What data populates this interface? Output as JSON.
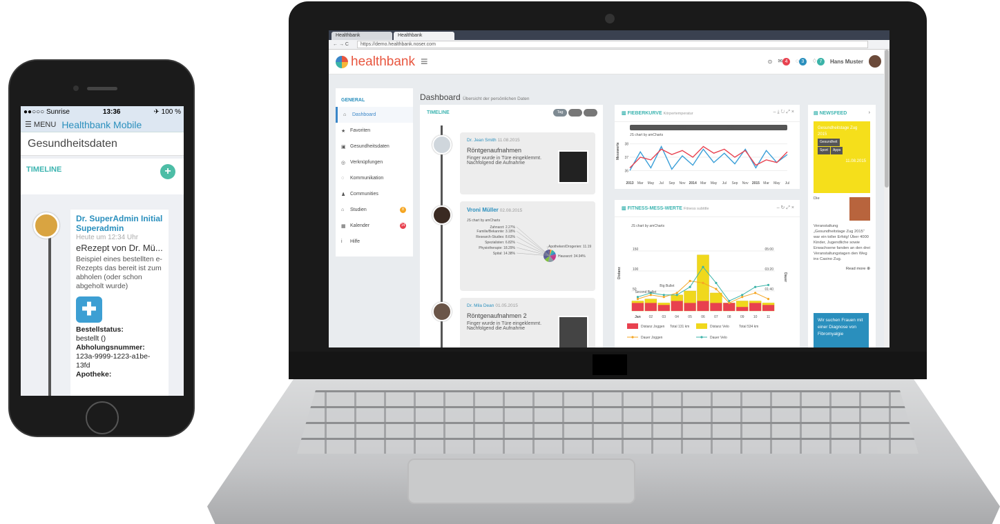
{
  "phone": {
    "status": {
      "carrier": "●●○○○ Sunrise",
      "time": "13:36",
      "battery": "✈ 100 %"
    },
    "nav": {
      "menu_label": "☰ MENU",
      "title": "Healthbank Mobile"
    },
    "page_title": "Gesundheitsdaten",
    "timeline_label": "TIMELINE",
    "add_icon": "plus-icon",
    "entry": {
      "author": "Dr. SuperAdmin Initial Superadmin",
      "time": "Heute um 12:34 Uhr",
      "subject": "eRezept von Dr. Mü...",
      "text": "Beispiel eines bestellten e-Rezepts das bereit ist zum abholen (oder schon abgeholt wurde)",
      "status_label": "Bestellstatus:",
      "status_value": "bestellt ()",
      "pickup_label": "Abholungsnummer:",
      "pickup_value": "123a-9999-1223-a1be-13fd",
      "pharmacy_label": "Apotheke:"
    }
  },
  "browser": {
    "tabs": [
      "Healthbank",
      "Healthbank"
    ],
    "url": "https://demo.healthbank.noser.com"
  },
  "app": {
    "logo": {
      "pre": "health",
      "post": "bank"
    },
    "user_name": "Hans Muster",
    "badges": {
      "mail": "4",
      "chat": "3",
      "notif": "7"
    },
    "sidebar": {
      "section": "GENERAL",
      "items": [
        {
          "label": "Dashboard",
          "icon": "home-icon"
        },
        {
          "label": "Favoriten",
          "icon": "star-icon"
        },
        {
          "label": "Gesundheitsdaten",
          "icon": "briefcase-icon"
        },
        {
          "label": "Verknüpfungen",
          "icon": "link-icon"
        },
        {
          "label": "Kommunikation",
          "icon": "chat-icon"
        },
        {
          "label": "Communities",
          "icon": "users-icon"
        },
        {
          "label": "Studien",
          "icon": "bank-icon",
          "badge": "8"
        },
        {
          "label": "Kalender",
          "icon": "calendar-icon",
          "badge": "14"
        },
        {
          "label": "Hilfe",
          "icon": "info-icon"
        }
      ]
    },
    "dashboard_title": "Dashboard",
    "dashboard_subtitle": "Übersicht der persönlichen Daten",
    "timeline": {
      "label": "TIMELINE",
      "buttons": [
        "Tag",
        "",
        ""
      ],
      "entries": [
        {
          "who": "Dr. Jean Smith",
          "date": "11.08.2015",
          "subject": "Röntgenaufnahmen",
          "text": "Finger wurde in Türe eingeklemmt. Nachfolgend die Aufnahme"
        },
        {
          "who": "Vroni Müller",
          "date": "02.08.2015"
        },
        {
          "who": "Dr. Mila Dean",
          "date": "01.05.2015",
          "subject": "Röntgenaufnahmen 2",
          "text": "Finger wurde in Türe eingeklemmt. Nachfolgend die Aufnahme"
        }
      ],
      "pie_note": "JS chart by amCharts"
    },
    "fever": {
      "title": "FIEBERKURVE",
      "subtitle": "Körpertemperatur",
      "note": "JS chart by amCharts",
      "ylabel": "Messwerte"
    },
    "fitness": {
      "title": "FITNESS-MESS-WERTE",
      "subtitle": "Fitness subtitle",
      "note": "JS chart by amCharts",
      "ylabel": "Distanz",
      "y2label": "Dauer"
    },
    "newsfeed": {
      "title": "NEWSFEED",
      "card_title": "Gesundheitstage Zug 2015",
      "tags": [
        "Gesundheit",
        "Sport",
        "Apps"
      ],
      "date": "11.08.2015",
      "lead": "Die",
      "text": "Veranstaltung „Gesundheitstage Zug 2015“ war ein toller Erfolg! Über 4000 Kinder, Jugendliche sowie Erwachsene fanden an den drei Veranstaltungstagen den Weg ins Casino Zug.",
      "read_more": "Read more",
      "blue_text": "Wir suchen Frauen mit einer Diagnose von Fibromyalgie"
    }
  },
  "chart_data": [
    {
      "type": "pie",
      "title": "",
      "categories": [
        "Zahnarzt",
        "Familie/Bekannte",
        "Research-Studies",
        "Spezialisten",
        "Physiotherapie",
        "Spital",
        "Apotheken/Drogerien",
        "Hausarzt"
      ],
      "values": [
        2.27,
        3.18,
        8.63,
        6.82,
        18.29,
        14.38,
        11.19,
        34.94
      ],
      "labels": [
        "Zahnarzt: 2.27%",
        "Familie/Bekannte: 3.18%",
        "Research-Studies: 8.63%",
        "Spezialisten: 6.82%",
        "Physiotherapie: 18.29%",
        "Spital: 14.38%",
        "Apotheken/Drogerien: 11.19%",
        "Hausarzt: 34.94%"
      ],
      "colors": [
        "#e8563f",
        "#f5b63a",
        "#3bb3a8",
        "#3a86c8",
        "#c23b8a",
        "#8a9aa6",
        "#7fbf3f",
        "#5b5f96"
      ]
    },
    {
      "type": "line",
      "title": "FIEBERKURVE",
      "ylabel": "Messwerte",
      "x": [
        "2013",
        "Mar",
        "May",
        "Jul",
        "Sep",
        "Nov",
        "2014",
        "Mar",
        "May",
        "Jul",
        "Sep",
        "Nov",
        "2015",
        "Mar",
        "May",
        "Jul"
      ],
      "yticks": [
        "38",
        "37",
        "36"
      ],
      "ylim": [
        35.5,
        38.5
      ],
      "series": [
        {
          "name": "",
          "values": [
            36.0,
            37.4,
            36.2,
            37.8,
            36.1,
            37.1,
            36.4,
            37.6,
            36.6,
            37.3,
            36.5,
            37.6,
            36.2,
            37.5,
            36.6,
            37.2
          ],
          "color": "#3a9fd8"
        },
        {
          "name": "",
          "values": [
            36.2,
            37.0,
            36.8,
            37.6,
            37.2,
            37.5,
            37.0,
            37.8,
            37.3,
            37.6,
            37.0,
            37.5,
            36.4,
            36.8,
            36.6,
            37.4
          ],
          "color": "#e8414f"
        }
      ],
      "scrollbar_labels": [
        "2014",
        "2015"
      ]
    },
    {
      "type": "bar",
      "title": "FITNESS-MESS-WERTE",
      "ylabel": "Distanz",
      "y2label": "Dauer",
      "categories": [
        "Jan",
        "02",
        "03",
        "04",
        "05",
        "06",
        "07",
        "08",
        "09",
        "10",
        "11"
      ],
      "yticks": [
        "150",
        "100",
        "50"
      ],
      "y2ticks": [
        "05:00",
        "03:20",
        "01:40"
      ],
      "ylim": [
        0,
        200
      ],
      "series": [
        {
          "name": "Distanz Joggen",
          "total": "Total 131 km",
          "values": [
            20,
            20,
            15,
            25,
            20,
            25,
            20,
            20,
            10,
            20,
            15
          ],
          "color": "#e8414f"
        },
        {
          "name": "Distanz Velo",
          "total": "Total 534 km",
          "values": [
            25,
            30,
            20,
            40,
            50,
            140,
            45,
            20,
            25,
            25,
            20
          ],
          "color": "#f0d81c"
        },
        {
          "name": "Dauer Joggen",
          "values": [
            30,
            40,
            35,
            45,
            75,
            70,
            55,
            20,
            35,
            45,
            30
          ],
          "color": "#f5a623"
        },
        {
          "name": "Dauer Velo",
          "values": [
            35,
            45,
            40,
            40,
            60,
            110,
            70,
            25,
            40,
            60,
            65
          ],
          "color": "#3bb3a8"
        }
      ],
      "annotations": [
        "Big Bullet",
        "Second Bullet"
      ]
    }
  ]
}
